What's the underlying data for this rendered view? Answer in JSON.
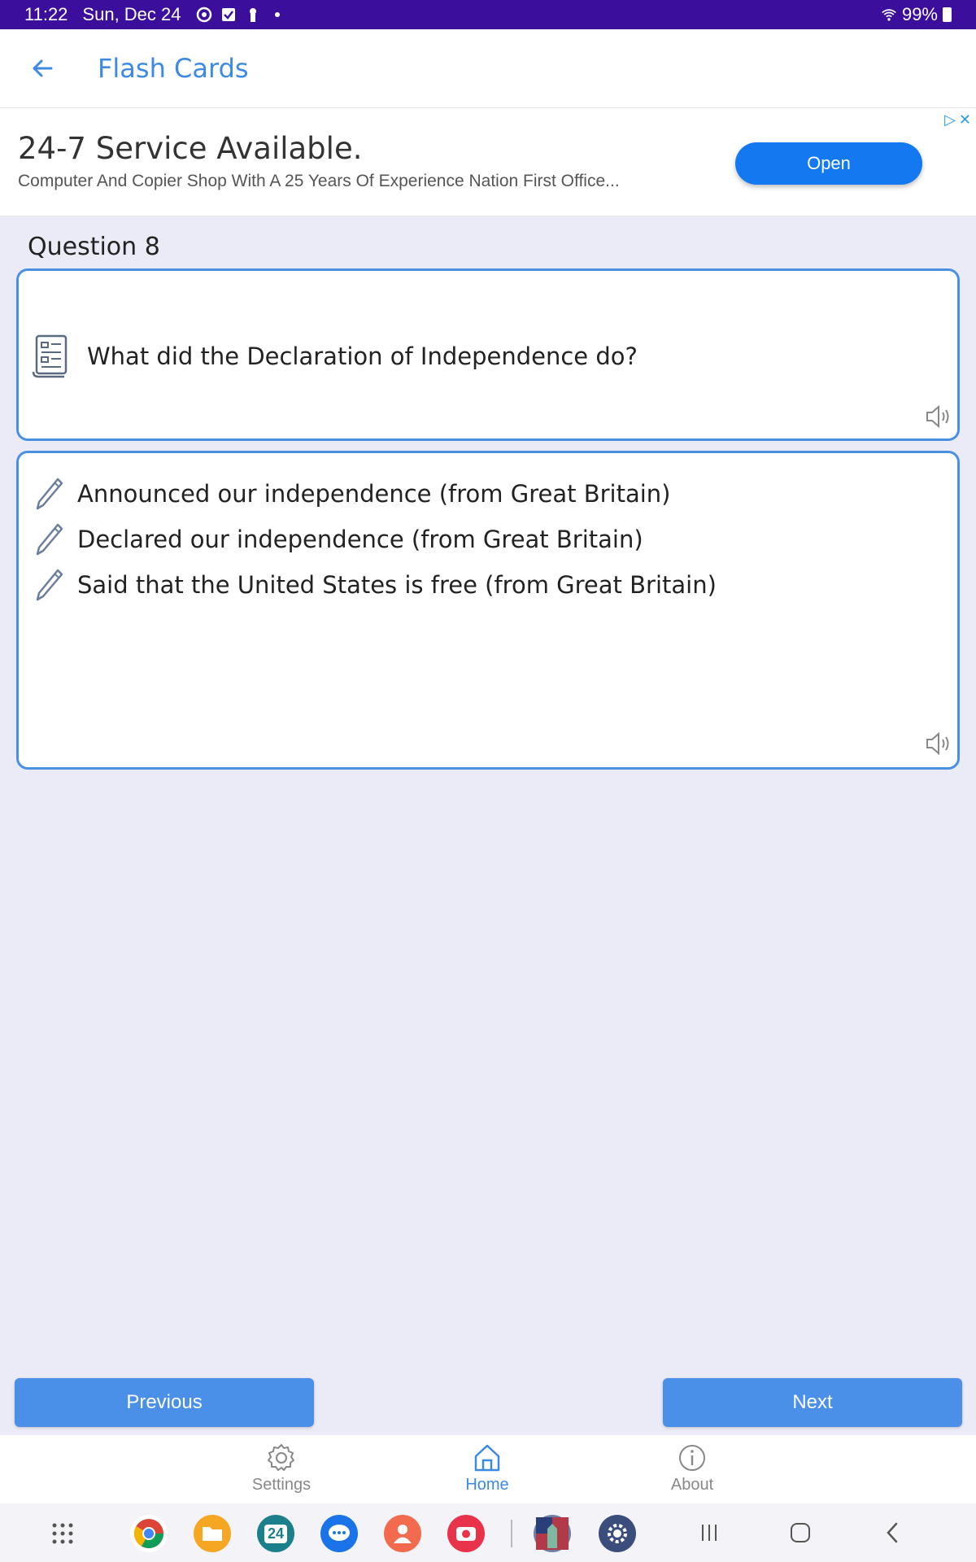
{
  "status_bar": {
    "time": "11:22",
    "date": "Sun, Dec 24",
    "battery": "99%"
  },
  "app_bar": {
    "title": "Flash Cards"
  },
  "ad": {
    "title": "24-7 Service Available.",
    "description": "Computer And Copier Shop With A 25 Years Of Experience Nation First Office...",
    "button_label": "Open"
  },
  "question": {
    "label": "Question 8",
    "text": "What did the Declaration of Independence do?"
  },
  "answers": [
    "Announced our independence (from Great Britain)",
    "Declared our independence (from Great Britain)",
    "Said that the United States is free (from Great Britain)"
  ],
  "buttons": {
    "previous": "Previous",
    "next": "Next"
  },
  "bottom_nav": {
    "settings": "Settings",
    "home": "Home",
    "about": "About",
    "active": "home"
  },
  "dock": {
    "calendar_day": "24"
  },
  "colors": {
    "accent": "#3d8ae6",
    "status_bar": "#3b0e9c",
    "card_border": "#4a90e2",
    "background": "#ebebf8"
  }
}
